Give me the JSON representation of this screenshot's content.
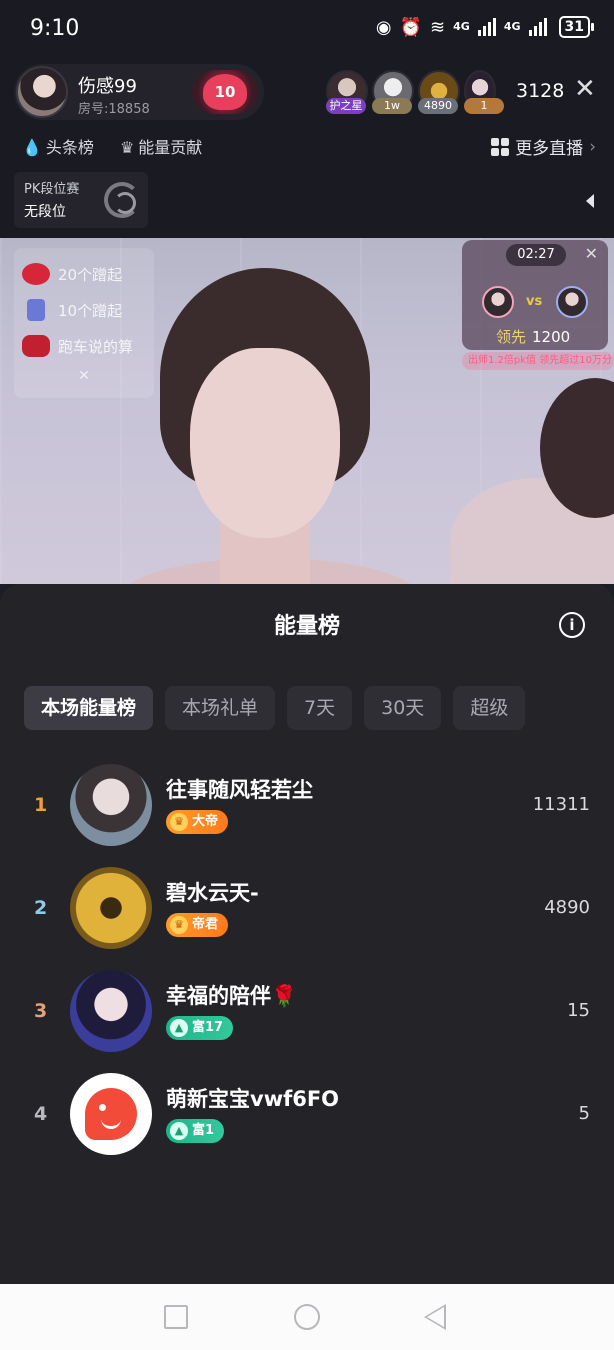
{
  "status_bar": {
    "time": "9:10",
    "network_1": "4G",
    "network_2": "4G",
    "battery": "31"
  },
  "host": {
    "name": "伤感99",
    "room": "房号:18858",
    "heart_level": "10"
  },
  "viewers": [
    {
      "tag": "护之星"
    },
    {
      "tag": "1w"
    },
    {
      "tag": "4890"
    },
    {
      "tag": "1"
    }
  ],
  "viewer_count": "3128",
  "sub_links": {
    "headlines": "头条榜",
    "energy": "能量贡献",
    "more_live": "更多直播"
  },
  "pk_rank": {
    "title": "PK段位赛",
    "rank": "无段位"
  },
  "gift_panel": [
    {
      "label": "20个蹭起"
    },
    {
      "label": "10个蹭起"
    },
    {
      "label": "跑车说的算"
    }
  ],
  "pk_card": {
    "timer": "02:27",
    "vs": "vs",
    "lead_label": "领先",
    "lead_value": "1200",
    "ticker": "出师1.2倍pk值 领先超过10万分"
  },
  "sheet": {
    "title": "能量榜",
    "tabs": [
      "本场能量榜",
      "本场礼单",
      "7天",
      "30天",
      "超级"
    ],
    "ranks": [
      {
        "num": "1",
        "name": "往事随风轻若尘",
        "badge": "大帝",
        "score": "11311",
        "num_color": "#f0a030"
      },
      {
        "num": "2",
        "name": "碧水云天-",
        "badge": "帝君",
        "score": "4890",
        "num_color": "#8ecbe8"
      },
      {
        "num": "3",
        "name": "幸福的陪伴🌹",
        "badge": "富17",
        "score": "15",
        "num_color": "#e2a27a"
      },
      {
        "num": "4",
        "name": "萌新宝宝vwf6FO",
        "badge": "富1",
        "score": "5",
        "num_color": "#b9b9c0"
      }
    ]
  }
}
